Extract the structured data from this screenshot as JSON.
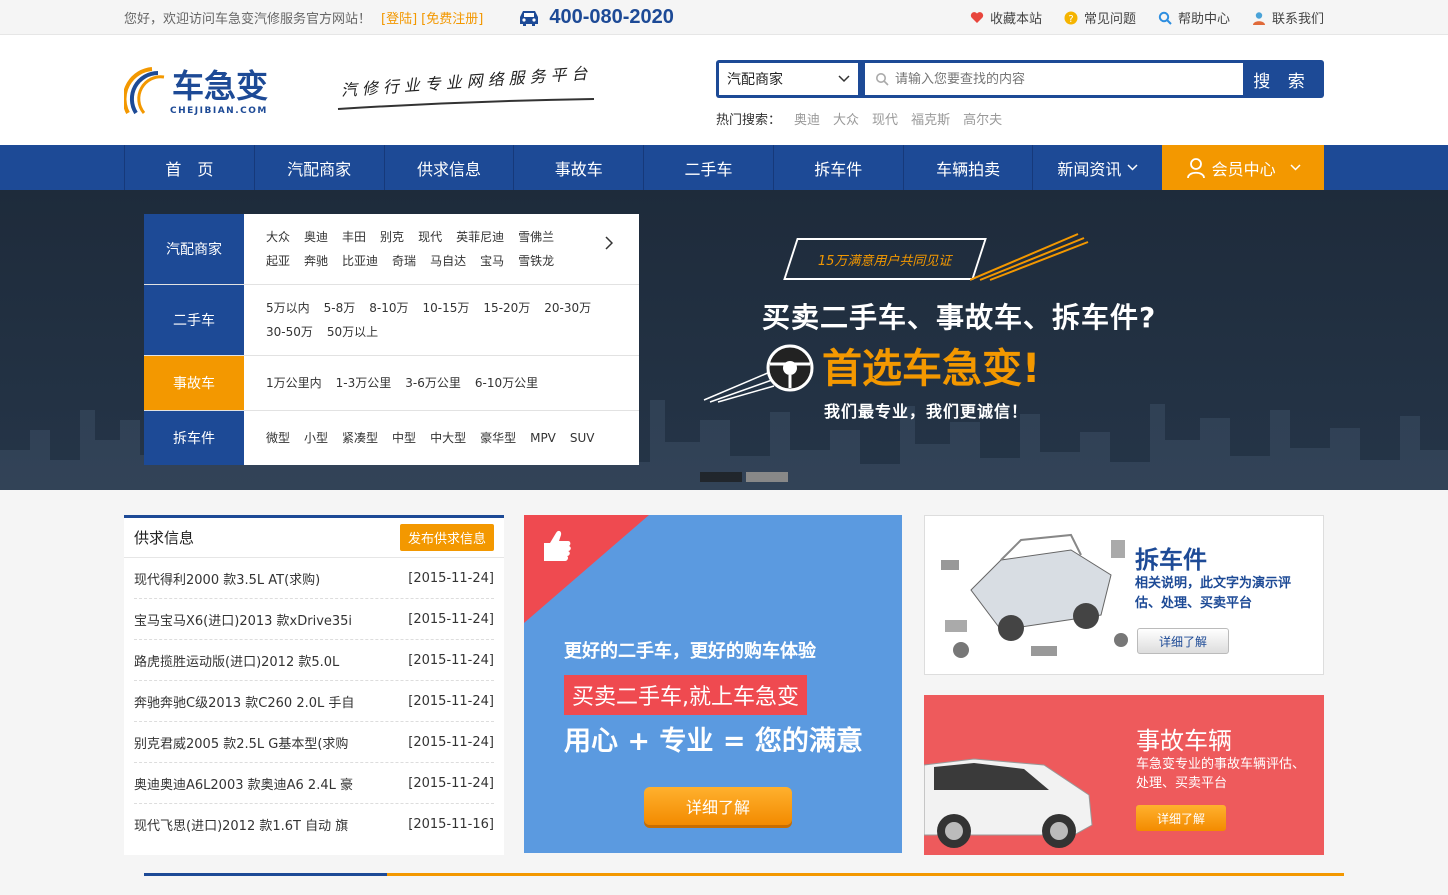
{
  "topbar": {
    "welcome": "您好，欢迎访问车急变汽修服务官方网站！",
    "login": "[登陆]",
    "register": "[免费注册]",
    "phone": "400-080-2020",
    "links": [
      "收藏本站",
      "常见问题",
      "帮助中心",
      "联系我们"
    ]
  },
  "header": {
    "logo_text": "车急变",
    "logo_sub": "CHEJIBIAN.COM",
    "slogan": "汽修行业专业网络服务平台",
    "search": {
      "category": "汽配商家",
      "placeholder": "请输入您要查找的内容",
      "button": "搜 索"
    },
    "hot_label": "热门搜索：",
    "hot_keywords": [
      "奥迪",
      "大众",
      "现代",
      "福克斯",
      "高尔夫"
    ]
  },
  "nav": {
    "items": [
      "首　页",
      "汽配商家",
      "供求信息",
      "事故车",
      "二手车",
      "拆车件",
      "车辆拍卖",
      "新闻资讯"
    ],
    "member": "会员中心"
  },
  "categories": [
    {
      "title": "汽配商家",
      "items": [
        "大众",
        "奥迪",
        "丰田",
        "别克",
        "现代",
        "英菲尼迪",
        "雪佛兰",
        "起亚",
        "奔驰",
        "比亚迪",
        "奇瑞",
        "马自达",
        "宝马",
        "雪铁龙"
      ]
    },
    {
      "title": "二手车",
      "items": [
        "5万以内",
        "5-8万",
        "8-10万",
        "10-15万",
        "15-20万",
        "20-30万",
        "30-50万",
        "50万以上"
      ]
    },
    {
      "title": "事故车",
      "items": [
        "1万公里内",
        "1-3万公里",
        "3-6万公里",
        "6-10万公里"
      ]
    },
    {
      "title": "拆车件",
      "items": [
        "微型",
        "小型",
        "紧凑型",
        "中型",
        "中大型",
        "豪华型",
        "MPV",
        "SUV"
      ]
    }
  ],
  "banner": {
    "badge": "15万满意用户共同见证",
    "line1": "买卖二手车、事故车、拆车件?",
    "line2": "首选车急变!",
    "line3": "我们最专业，我们更诚信！"
  },
  "supply": {
    "title": "供求信息",
    "button": "发布供求信息",
    "rows": [
      {
        "text": "现代得利2000 款3.5L AT(求购)",
        "date": "[2015-11-24]"
      },
      {
        "text": "宝马宝马X6(进口)2013 款xDrive35i",
        "date": "[2015-11-24]"
      },
      {
        "text": "路虎揽胜运动版(进口)2012 款5.0L",
        "date": "[2015-11-24]"
      },
      {
        "text": "奔驰奔驰C级2013 款C260 2.0L 手自",
        "date": "[2015-11-24]"
      },
      {
        "text": "别克君威2005 款2.5L G基本型(求购",
        "date": "[2015-11-24]"
      },
      {
        "text": "奥迪奥迪A6L2003 款奥迪A6 2.4L 豪",
        "date": "[2015-11-24]"
      },
      {
        "text": "现代飞思(进口)2012 款1.6T 自动 旗",
        "date": "[2015-11-16]"
      }
    ]
  },
  "mid_banner": {
    "line1": "更好的二手车，更好的购车体验",
    "line2": "买卖二手车,就上车急变",
    "line3": "用心 + 专业 = 您的满意",
    "button": "详细了解"
  },
  "parts_card": {
    "title": "拆车件",
    "desc": "相关说明，此文字为演示评估、处理、买卖平台",
    "button": "详细了解"
  },
  "accident_card": {
    "title": "事故车辆",
    "desc": "车急变专业的事故车辆评估、处理、买卖平台",
    "button": "详细了解"
  },
  "colors": {
    "brand_blue": "#1d4a96",
    "accent_orange": "#f39800"
  }
}
